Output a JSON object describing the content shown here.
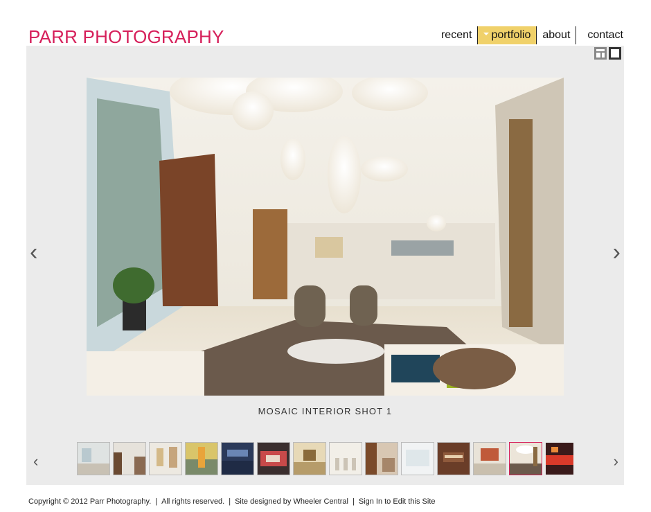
{
  "brand": "PARR PHOTOGRAPHY",
  "nav": {
    "recent": "recent",
    "portfolio": "portfolio",
    "about": "about",
    "contact": "contact"
  },
  "gallery": {
    "prev_glyph": "‹",
    "next_glyph": "›",
    "caption": "MOSAIC INTERIOR SHOT 1",
    "current_index": 13,
    "thumbnails": 14,
    "view_icons": [
      "grid-view-icon",
      "single-view-icon"
    ]
  },
  "footer": {
    "copyright": "Copyright © 2012 Parr Photography.",
    "rights": "All rights reserved.",
    "designer": "Site designed by Wheeler Central",
    "signin": "Sign In to Edit this Site",
    "divider": "|"
  },
  "colors": {
    "brand": "#d61f5a",
    "nav_active": "#f0d16a",
    "stage_bg": "#ebebeb"
  }
}
